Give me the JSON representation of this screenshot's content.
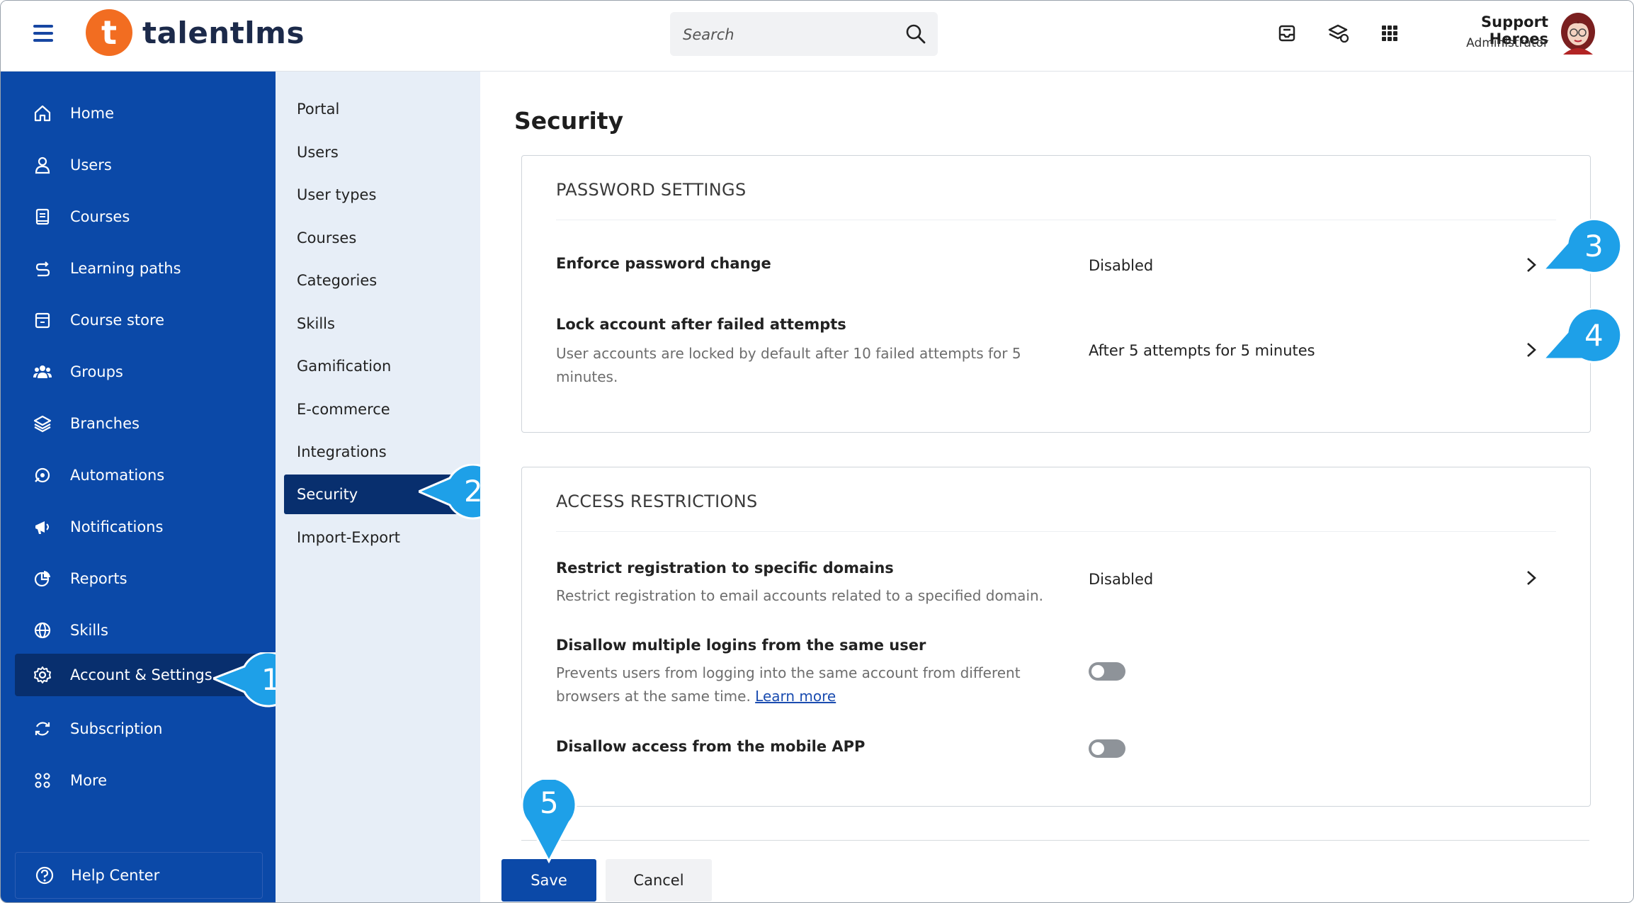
{
  "app": {
    "logo_text": "talentlms",
    "logo_letter": "t"
  },
  "header": {
    "search_placeholder": "Search",
    "user_name": "Support Heroes",
    "user_role": "Administrator"
  },
  "sidebar": {
    "items": [
      {
        "label": "Home",
        "icon": "home-icon"
      },
      {
        "label": "Users",
        "icon": "user-icon"
      },
      {
        "label": "Courses",
        "icon": "book-icon"
      },
      {
        "label": "Learning paths",
        "icon": "path-icon"
      },
      {
        "label": "Course store",
        "icon": "store-icon"
      },
      {
        "label": "Groups",
        "icon": "groups-icon"
      },
      {
        "label": "Branches",
        "icon": "layers-icon"
      },
      {
        "label": "Automations",
        "icon": "automation-icon"
      },
      {
        "label": "Notifications",
        "icon": "megaphone-icon"
      },
      {
        "label": "Reports",
        "icon": "pie-chart-icon"
      },
      {
        "label": "Skills",
        "icon": "globe-icon"
      },
      {
        "label": "Account & Settings",
        "icon": "gear-icon"
      },
      {
        "label": "Subscription",
        "icon": "refresh-icon"
      },
      {
        "label": "More",
        "icon": "grid-icon"
      }
    ],
    "active": "Account & Settings",
    "help_label": "Help Center"
  },
  "subnav": {
    "items": [
      "Portal",
      "Users",
      "User types",
      "Courses",
      "Categories",
      "Skills",
      "Gamification",
      "E-commerce",
      "Integrations",
      "Security",
      "Import-Export"
    ],
    "active": "Security"
  },
  "page": {
    "title": "Security",
    "password_settings": {
      "heading": "PASSWORD SETTINGS",
      "enforce_label": "Enforce password change",
      "enforce_value": "Disabled",
      "lock_label": "Lock account after failed attempts",
      "lock_desc": "User accounts are locked by default after 10 failed attempts for 5 minutes.",
      "lock_value": "After 5 attempts for 5 minutes"
    },
    "access_restrictions": {
      "heading": "ACCESS RESTRICTIONS",
      "restrict_label": "Restrict registration to specific domains",
      "restrict_desc": "Restrict registration to email accounts related to a specified domain.",
      "restrict_value": "Disabled",
      "multi_label": "Disallow multiple logins from the same user",
      "multi_desc": "Prevents users from logging into the same account from different browsers at the same time.",
      "multi_link": "Learn more",
      "multi_enabled": false,
      "mobile_label": "Disallow access from the mobile APP",
      "mobile_enabled": false
    },
    "save_label": "Save",
    "cancel_label": "Cancel"
  },
  "callouts": [
    "1",
    "2",
    "3",
    "4",
    "5"
  ],
  "colors": {
    "sidebar": "#0b49a8",
    "active": "#082f6e",
    "subnav": "#e7eef7",
    "brand": "#f26d21",
    "callout": "#1ea0e8"
  }
}
